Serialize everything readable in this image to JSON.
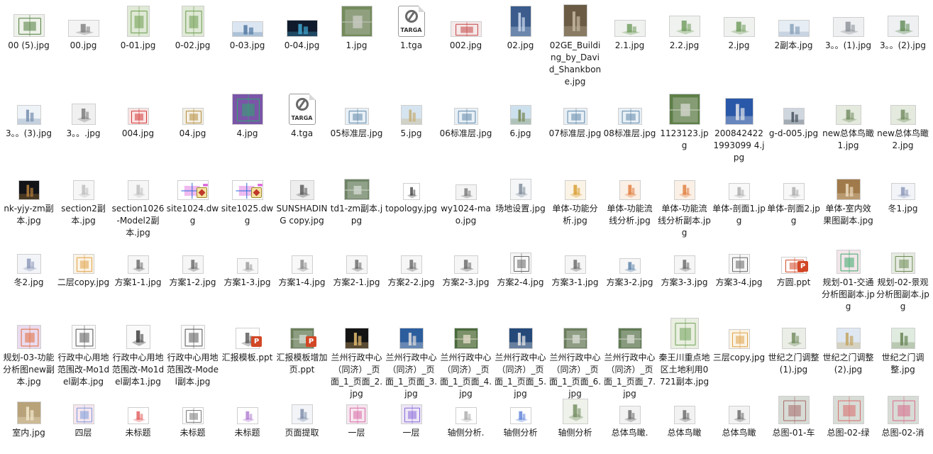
{
  "files": [
    {
      "name": "00 (5).jpg",
      "thumb": {
        "w": 44,
        "h": 32,
        "bg": "#eef2ea",
        "accent": "#4f7a3a",
        "kind": "plan"
      }
    },
    {
      "name": "00.jpg",
      "thumb": {
        "w": 44,
        "h": 24,
        "bg": "#f4f4f4",
        "accent": "#7c7c7c",
        "kind": "model"
      }
    },
    {
      "name": "0-01.jpg",
      "thumb": {
        "w": 32,
        "h": 44,
        "bg": "#dfe9d6",
        "accent": "#6a9a4c",
        "kind": "plan"
      }
    },
    {
      "name": "0-02.jpg",
      "thumb": {
        "w": 32,
        "h": 44,
        "bg": "#dfe9d6",
        "accent": "#6a9a4c",
        "kind": "plan"
      }
    },
    {
      "name": "0-03.jpg",
      "thumb": {
        "w": 44,
        "h": 22,
        "bg": "#dbe6f2",
        "accent": "#5a7ea6",
        "kind": "render"
      }
    },
    {
      "name": "0-04.jpg",
      "thumb": {
        "w": 44,
        "h": 24,
        "bg": "#0f1a2c",
        "accent": "#3ea0c8",
        "kind": "render"
      }
    },
    {
      "name": "1.jpg",
      "thumb": {
        "w": 44,
        "h": 44,
        "bg": "#748b5c",
        "accent": "#c7c9c0",
        "kind": "aerial"
      }
    },
    {
      "name": "1.tga",
      "thumb": {
        "kind": "tga",
        "label": "TARGA"
      }
    },
    {
      "name": "002.jpg",
      "thumb": {
        "w": 44,
        "h": 22,
        "bg": "#f5e9e9",
        "accent": "#c44444",
        "kind": "plan"
      }
    },
    {
      "name": "02.jpg",
      "thumb": {
        "w": 30,
        "h": 44,
        "bg": "#3b5c8c",
        "accent": "#c9d6ea",
        "kind": "render"
      }
    },
    {
      "name": "02GE_Building_by_David_Shankbone.jpg",
      "thumb": {
        "w": 34,
        "h": 46,
        "bg": "#6b5b45",
        "accent": "#c2b59c",
        "kind": "render"
      }
    },
    {
      "name": "2.1.jpg",
      "thumb": {
        "w": 44,
        "h": 24,
        "bg": "#f0f2ef",
        "accent": "#6d9a5a",
        "kind": "model"
      }
    },
    {
      "name": "2.2.jpg",
      "thumb": {
        "w": 44,
        "h": 30,
        "bg": "#f0f2ef",
        "accent": "#6d9a5a",
        "kind": "model"
      }
    },
    {
      "name": "2.jpg",
      "thumb": {
        "w": 44,
        "h": 28,
        "bg": "#f0f2ef",
        "accent": "#6d9a5a",
        "kind": "model"
      }
    },
    {
      "name": "2副本.jpg",
      "thumb": {
        "w": 44,
        "h": 24,
        "bg": "#e6edf4",
        "accent": "#8fa6bf",
        "kind": "render"
      }
    },
    {
      "name": "3。。(1).jpg",
      "thumb": {
        "w": 44,
        "h": 28,
        "bg": "#eef0f2",
        "accent": "#8a8f96",
        "kind": "model"
      }
    },
    {
      "name": "3。。(2).jpg",
      "thumb": {
        "w": 44,
        "h": 30,
        "bg": "#eef0f2",
        "accent": "#5f8a55",
        "kind": "model"
      }
    },
    {
      "name": "3。。(3).jpg",
      "thumb": {
        "w": 34,
        "h": 28,
        "bg": "#eef3f8",
        "accent": "#7b93b1",
        "kind": "render"
      }
    },
    {
      "name": "3。。.jpg",
      "thumb": {
        "w": 34,
        "h": 30,
        "bg": "#f0f0f0",
        "accent": "#777777",
        "kind": "model"
      }
    },
    {
      "name": "004.jpg",
      "thumb": {
        "w": 30,
        "h": 24,
        "bg": "#fbe3e3",
        "accent": "#d13a3a",
        "kind": "plan"
      }
    },
    {
      "name": "04.jpg",
      "thumb": {
        "w": 30,
        "h": 24,
        "bg": "#f3efe4",
        "accent": "#b58c3c",
        "kind": "plan"
      }
    },
    {
      "name": "4.jpg",
      "thumb": {
        "w": 44,
        "h": 44,
        "bg": "#7a55a8",
        "accent": "#2fa86f",
        "kind": "plan"
      }
    },
    {
      "name": "4.tga",
      "thumb": {
        "kind": "tga",
        "label": "TARGA"
      }
    },
    {
      "name": "05标准层.jpg",
      "thumb": {
        "w": 34,
        "h": 24,
        "bg": "#e8f0f6",
        "accent": "#5e86a8",
        "kind": "plan"
      }
    },
    {
      "name": "5.jpg",
      "thumb": {
        "w": 30,
        "h": 28,
        "bg": "#d6e4f0",
        "accent": "#c7b07a",
        "kind": "render"
      }
    },
    {
      "name": "06标准层.jpg",
      "thumb": {
        "w": 34,
        "h": 24,
        "bg": "#e8f0f6",
        "accent": "#5e86a8",
        "kind": "plan"
      }
    },
    {
      "name": "6.jpg",
      "thumb": {
        "w": 30,
        "h": 28,
        "bg": "#cde0ee",
        "accent": "#7a8b5a",
        "kind": "render"
      }
    },
    {
      "name": "07标准层.jpg",
      "thumb": {
        "w": 34,
        "h": 24,
        "bg": "#e8f0f6",
        "accent": "#5e86a8",
        "kind": "plan"
      }
    },
    {
      "name": "08标准层.jpg",
      "thumb": {
        "w": 34,
        "h": 24,
        "bg": "#e8f0f6",
        "accent": "#5e86a8",
        "kind": "plan"
      }
    },
    {
      "name": "1123123.jpg",
      "thumb": {
        "w": 44,
        "h": 44,
        "bg": "#5e7f48",
        "accent": "#cfd3c8",
        "kind": "aerial"
      }
    },
    {
      "name": "2008424221993099 4.jpg",
      "thumb": {
        "w": 40,
        "h": 38,
        "bg": "#2a58a8",
        "accent": "#d8dde6",
        "kind": "render"
      }
    },
    {
      "name": "g-d-005.jpg",
      "thumb": {
        "w": 30,
        "h": 24,
        "bg": "#cfd6de",
        "accent": "#4d5a66",
        "kind": "render"
      }
    },
    {
      "name": "new总体鸟瞰1.jpg",
      "thumb": {
        "w": 36,
        "h": 28,
        "bg": "#e4eade",
        "accent": "#6f8a5c",
        "kind": "model"
      }
    },
    {
      "name": "new总体鸟瞰2.jpg",
      "thumb": {
        "w": 36,
        "h": 28,
        "bg": "#e4eade",
        "accent": "#6f8a5c",
        "kind": "model"
      }
    },
    {
      "name": "nk-yjy-zm副本.jpg",
      "thumb": {
        "w": 30,
        "h": 28,
        "bg": "#121418",
        "accent": "#b07a3a",
        "kind": "render"
      }
    },
    {
      "name": "section2副本.jpg",
      "thumb": {
        "w": 30,
        "h": 28,
        "bg": "#f6f6f6",
        "accent": "#bdbdbd",
        "kind": "model"
      }
    },
    {
      "name": "section1026-Model2副本.jpg",
      "thumb": {
        "w": 30,
        "h": 28,
        "bg": "#f6f6f6",
        "accent": "#bdbdbd",
        "kind": "model"
      }
    },
    {
      "name": "site1024.dwg",
      "thumb": {
        "w": 44,
        "h": 28,
        "bg": "#ffffff",
        "accent": "#d23ad2",
        "kind": "dwg"
      },
      "badge": "dwg"
    },
    {
      "name": "site1025.dwg",
      "thumb": {
        "w": 44,
        "h": 28,
        "bg": "#ffffff",
        "accent": "#d23ad2",
        "kind": "dwg"
      },
      "badge": "dwg"
    },
    {
      "name": "SUNSHADING copy.jpg",
      "thumb": {
        "w": 34,
        "h": 28,
        "bg": "#eeeeee",
        "accent": "#555555",
        "kind": "model"
      }
    },
    {
      "name": "td1-zm副本.jpg",
      "thumb": {
        "w": 36,
        "h": 30,
        "bg": "#6f8466",
        "accent": "#cfd6cc",
        "kind": "aerial"
      }
    },
    {
      "name": "topology.jpg",
      "thumb": {
        "w": 24,
        "h": 24,
        "bg": "#ffffff",
        "accent": "#444444",
        "kind": "model"
      }
    },
    {
      "name": "wy1024-mao.jpg",
      "thumb": {
        "w": 30,
        "h": 22,
        "bg": "#f4f4f4",
        "accent": "#777777",
        "kind": "model"
      }
    },
    {
      "name": "场地设置.jpg",
      "thumb": {
        "w": 30,
        "h": 30,
        "bg": "#f4f6f8",
        "accent": "#7a8896",
        "kind": "model"
      }
    },
    {
      "name": "单体-功能分析.jpg",
      "thumb": {
        "w": 30,
        "h": 28,
        "bg": "#fbf4e6",
        "accent": "#d89a2a",
        "kind": "model"
      }
    },
    {
      "name": "单体-功能流线分析.jpg",
      "thumb": {
        "w": 30,
        "h": 28,
        "bg": "#fbf0e6",
        "accent": "#e07a3a",
        "kind": "model"
      }
    },
    {
      "name": "单体-功能流线分析副本.jpg",
      "thumb": {
        "w": 30,
        "h": 28,
        "bg": "#fbf0e6",
        "accent": "#e07a3a",
        "kind": "model"
      }
    },
    {
      "name": "单体-剖面1.jpg",
      "thumb": {
        "w": 30,
        "h": 24,
        "bg": "#f8f8f8",
        "accent": "#aaaaaa",
        "kind": "model"
      }
    },
    {
      "name": "单体-剖面2.jpg",
      "thumb": {
        "w": 30,
        "h": 24,
        "bg": "#f8f8f8",
        "accent": "#aaaaaa",
        "kind": "model"
      }
    },
    {
      "name": "单体-室内效果图副本.jpg",
      "thumb": {
        "w": 34,
        "h": 30,
        "bg": "#a07a4a",
        "accent": "#e8d6b8",
        "kind": "render"
      }
    },
    {
      "name": "冬1.jpg",
      "thumb": {
        "w": 34,
        "h": 24,
        "bg": "#f2f4f8",
        "accent": "#8a96b8",
        "kind": "model"
      }
    },
    {
      "name": "冬2.jpg",
      "thumb": {
        "w": 34,
        "h": 28,
        "bg": "#f2f4f8",
        "accent": "#8a96b8",
        "kind": "model"
      }
    },
    {
      "name": "二层copy.jpg",
      "thumb": {
        "w": 30,
        "h": 28,
        "bg": "#fbf3e4",
        "accent": "#e0a24a",
        "kind": "plan"
      }
    },
    {
      "name": "方案1-1.jpg",
      "thumb": {
        "w": 30,
        "h": 26,
        "bg": "#f6f6f6",
        "accent": "#666666",
        "kind": "model"
      }
    },
    {
      "name": "方案1-2.jpg",
      "thumb": {
        "w": 30,
        "h": 26,
        "bg": "#f6f6f6",
        "accent": "#666666",
        "kind": "model"
      }
    },
    {
      "name": "方案1-3.jpg",
      "thumb": {
        "w": 30,
        "h": 22,
        "bg": "#f8f8f8",
        "accent": "#999999",
        "kind": "model"
      }
    },
    {
      "name": "方案1-4.jpg",
      "thumb": {
        "w": 30,
        "h": 26,
        "bg": "#f8f8f8",
        "accent": "#888888",
        "kind": "model"
      }
    },
    {
      "name": "方案2-1.jpg",
      "thumb": {
        "w": 30,
        "h": 26,
        "bg": "#f6f6f6",
        "accent": "#666666",
        "kind": "model"
      }
    },
    {
      "name": "方案2-2.jpg",
      "thumb": {
        "w": 30,
        "h": 26,
        "bg": "#f6f6f6",
        "accent": "#666666",
        "kind": "model"
      }
    },
    {
      "name": "方案2-3.jpg",
      "thumb": {
        "w": 34,
        "h": 26,
        "bg": "#f6f6f6",
        "accent": "#666666",
        "kind": "model"
      }
    },
    {
      "name": "方案2-4.jpg",
      "thumb": {
        "w": 30,
        "h": 30,
        "bg": "#f6f6f6",
        "accent": "#666666",
        "kind": "plan"
      }
    },
    {
      "name": "方案3-1.jpg",
      "thumb": {
        "w": 30,
        "h": 26,
        "bg": "#f6f6f6",
        "accent": "#666666",
        "kind": "model"
      }
    },
    {
      "name": "方案3-2.jpg",
      "thumb": {
        "w": 30,
        "h": 22,
        "bg": "#f6f6f6",
        "accent": "#5a7fa8",
        "kind": "model"
      }
    },
    {
      "name": "方案3-3.jpg",
      "thumb": {
        "w": 30,
        "h": 26,
        "bg": "#f6f6f6",
        "accent": "#666666",
        "kind": "model"
      }
    },
    {
      "name": "方案3-4.jpg",
      "thumb": {
        "w": 30,
        "h": 28,
        "bg": "#f6f6f6",
        "accent": "#666666",
        "kind": "plan"
      }
    },
    {
      "name": "方圆.ppt",
      "thumb": {
        "w": 36,
        "h": 24,
        "bg": "#ffffff",
        "accent": "#d24726",
        "kind": "plan"
      },
      "badge": "ppt"
    },
    {
      "name": "规划-01-交通分析图副本.jpg",
      "thumb": {
        "w": 34,
        "h": 34,
        "bg": "#f3e6ea",
        "accent": "#3aa86a",
        "kind": "plan"
      }
    },
    {
      "name": "规划-02-景观分析图副本.jpg",
      "thumb": {
        "w": 34,
        "h": 30,
        "bg": "#e6ebe2",
        "accent": "#6c8a52",
        "kind": "plan"
      }
    },
    {
      "name": "规划-03-功能分析图new副本.jpg",
      "thumb": {
        "w": 34,
        "h": 34,
        "bg": "#eadbef",
        "accent": "#e06a3a",
        "kind": "plan"
      }
    },
    {
      "name": "行政中心用地范围改-Mo1del副本.jpg",
      "thumb": {
        "w": 34,
        "h": 34,
        "bg": "#fafafa",
        "accent": "#555555",
        "kind": "plan"
      }
    },
    {
      "name": "行政中心用地范围改-Mo1del副本1.jpg",
      "thumb": {
        "w": 34,
        "h": 34,
        "bg": "#fafafa",
        "accent": "#333333",
        "kind": "model"
      }
    },
    {
      "name": "行政中心用地范围改-Model副本.jpg",
      "thumb": {
        "w": 34,
        "h": 34,
        "bg": "#fafafa",
        "accent": "#555555",
        "kind": "plan"
      }
    },
    {
      "name": "汇报模板.ppt",
      "thumb": {
        "w": 34,
        "h": 30,
        "bg": "#ffffff",
        "accent": "#555555",
        "kind": "model"
      },
      "badge": "ppt"
    },
    {
      "name": "汇报模板增加页.ppt",
      "thumb": {
        "w": 34,
        "h": 30,
        "bg": "#6a7f5a",
        "accent": "#cfd6cc",
        "kind": "aerial"
      },
      "badge": "ppt"
    },
    {
      "name": "兰州行政中心（同济）_页面_1_页面_2.jpg",
      "thumb": {
        "w": 34,
        "h": 30,
        "bg": "#141414",
        "accent": "#d9b26a",
        "kind": "render"
      }
    },
    {
      "name": "兰州行政中心（同济）_页面_1_页面_3.jpg",
      "thumb": {
        "w": 34,
        "h": 30,
        "bg": "#2c5e9e",
        "accent": "#d8d8d8",
        "kind": "render"
      }
    },
    {
      "name": "兰州行政中心（同济）_页面_1_页面_4.jpg",
      "thumb": {
        "w": 34,
        "h": 30,
        "bg": "#486a3a",
        "accent": "#dcd6c2",
        "kind": "aerial"
      }
    },
    {
      "name": "兰州行政中心（同济）_页面_1_页面_5.jpg",
      "thumb": {
        "w": 34,
        "h": 30,
        "bg": "#254a7a",
        "accent": "#e6e6e6",
        "kind": "render"
      }
    },
    {
      "name": "兰州行政中心（同济）_页面_1_页面_6.jpg",
      "thumb": {
        "w": 34,
        "h": 30,
        "bg": "#6a7e5c",
        "accent": "#d4d8ce",
        "kind": "aerial"
      }
    },
    {
      "name": "兰州行政中心（同济）_页面_1_页面_7.jpg",
      "thumb": {
        "w": 34,
        "h": 30,
        "bg": "#5f7a52",
        "accent": "#d4d8ce",
        "kind": "aerial"
      }
    },
    {
      "name": "秦王川重点地区土地利用0721副本.jpg",
      "thumb": {
        "w": 40,
        "h": 44,
        "bg": "#e9efe0",
        "accent": "#6fa05a",
        "kind": "plan"
      }
    },
    {
      "name": "三层copy.jpg",
      "thumb": {
        "w": 30,
        "h": 28,
        "bg": "#fbf3e4",
        "accent": "#e0a24a",
        "kind": "plan"
      }
    },
    {
      "name": "世纪之门调整(1).jpg",
      "thumb": {
        "w": 34,
        "h": 30,
        "bg": "#eaeee6",
        "accent": "#6f8a5c",
        "kind": "model"
      }
    },
    {
      "name": "世纪之门调整(2).jpg",
      "thumb": {
        "w": 34,
        "h": 30,
        "bg": "#dfe8f2",
        "accent": "#c4a86a",
        "kind": "render"
      }
    },
    {
      "name": "世纪之门调整.jpg",
      "thumb": {
        "w": 34,
        "h": 30,
        "bg": "#e0ebe0",
        "accent": "#6f8a5c",
        "kind": "render"
      }
    },
    {
      "name": "室内.jpg",
      "thumb": {
        "w": 34,
        "h": 32,
        "bg": "#b8a27a",
        "accent": "#f0e4c8",
        "kind": "render"
      }
    },
    {
      "name": "四层",
      "thumb": {
        "w": 30,
        "h": 28,
        "bg": "#f6e6ee",
        "accent": "#7a9ad8",
        "kind": "plan"
      }
    },
    {
      "name": "未标题",
      "thumb": {
        "w": 30,
        "h": 24,
        "bg": "#ffffff",
        "accent": "#e05a5a",
        "kind": "model"
      }
    },
    {
      "name": "未标题",
      "thumb": {
        "w": 30,
        "h": 24,
        "bg": "#ffffff",
        "accent": "#777777",
        "kind": "plan"
      }
    },
    {
      "name": "未标题",
      "thumb": {
        "w": 30,
        "h": 24,
        "bg": "#ffffff",
        "accent": "#b07ad0",
        "kind": "model"
      }
    },
    {
      "name": "页面提取",
      "thumb": {
        "w": 30,
        "h": 28,
        "bg": "#f2f4f8",
        "accent": "#7a8aa8",
        "kind": "model"
      }
    },
    {
      "name": "一层",
      "thumb": {
        "w": 30,
        "h": 28,
        "bg": "#f6e6ee",
        "accent": "#d86aa8",
        "kind": "plan"
      }
    },
    {
      "name": "一层",
      "thumb": {
        "w": 30,
        "h": 28,
        "bg": "#ece6f6",
        "accent": "#8a6ad8",
        "kind": "plan"
      }
    },
    {
      "name": "轴侧分析.",
      "thumb": {
        "w": 30,
        "h": 24,
        "bg": "#ffffff",
        "accent": "#aaaaaa",
        "kind": "model"
      }
    },
    {
      "name": "轴侧分析",
      "thumb": {
        "w": 30,
        "h": 24,
        "bg": "#ffffff",
        "accent": "#5a7fd8",
        "kind": "model"
      }
    },
    {
      "name": "轴侧分析",
      "thumb": {
        "w": 36,
        "h": 36,
        "bg": "#eef2ea",
        "accent": "#6f8a5c",
        "kind": "model"
      }
    },
    {
      "name": "总体鸟瞰.",
      "thumb": {
        "w": 30,
        "h": 26,
        "bg": "#f2f2f2",
        "accent": "#666666",
        "kind": "model"
      }
    },
    {
      "name": "总体鸟瞰",
      "thumb": {
        "w": 30,
        "h": 26,
        "bg": "#f2f2f2",
        "accent": "#666666",
        "kind": "model"
      }
    },
    {
      "name": "总体鸟瞰",
      "thumb": {
        "w": 30,
        "h": 26,
        "bg": "#f2f2f2",
        "accent": "#666666",
        "kind": "model"
      }
    },
    {
      "name": "总图-01-车",
      "thumb": {
        "w": 44,
        "h": 40,
        "bg": "#d8dcd6",
        "accent": "#a86a6a",
        "kind": "plan"
      }
    },
    {
      "name": "总图-02-绿",
      "thumb": {
        "w": 44,
        "h": 40,
        "bg": "#d8dcd6",
        "accent": "#d86a6a",
        "kind": "plan"
      }
    },
    {
      "name": "总图-02-消",
      "thumb": {
        "w": 44,
        "h": 40,
        "bg": "#d8dcd6",
        "accent": "#d86a8a",
        "kind": "plan"
      }
    }
  ]
}
